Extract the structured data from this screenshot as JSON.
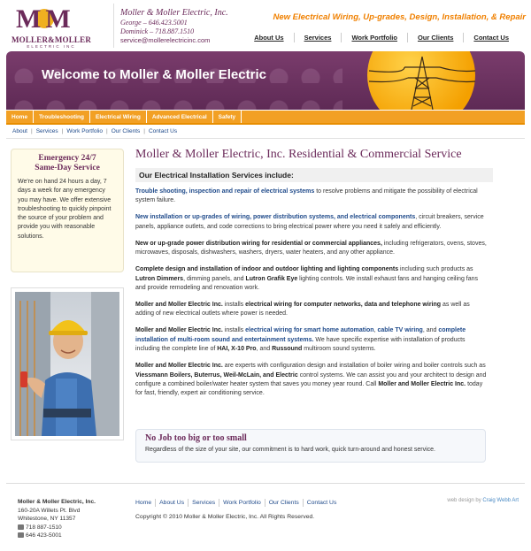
{
  "header": {
    "logo_mark_left": "M",
    "logo_mark_amp": "&",
    "logo_mark_right": "M",
    "logo_name": "MOLLER&MOLLER",
    "logo_sub": "ELECTRIC INC",
    "company": "Moller & Moller Electric, Inc.",
    "george": "George – 646.423.5001",
    "dominick": "Dominick – 718.887.1510",
    "email": "service@mollerelectricinc.com",
    "tagline": "New Electrical Wiring, Up-grades, Design, Installation, & Repair",
    "nav": [
      "About Us",
      "Services",
      "Work Portfolio",
      "Our Clients",
      "Contact Us"
    ]
  },
  "banner": {
    "title": "Welcome to Moller & Moller Electric"
  },
  "orange_nav": [
    "Home",
    "Troubleshooting",
    "Electrical Wiring",
    "Advanced Electrical",
    "Safety"
  ],
  "sub_nav": [
    "About",
    "Services",
    "Work Portfolio",
    "Our Clients",
    "Contact Us"
  ],
  "emergency": {
    "title_line1": "Emergency 24/7",
    "title_line2": "Same-Day Service",
    "body": "We're on hand 24 hours a day, 7 days a week for any emergency you may have. We offer extensive troubleshooting to quickly pinpoint the source of your problem and provide you with reasonable solutions."
  },
  "main": {
    "title": "Moller & Moller Electric, Inc. Residential & Commercial Service",
    "section_heading": "Our Electrical Installation Services include:",
    "p1_blue": "Trouble shooting, inspection and repair of electrical systems",
    "p1_rest": " to resolve problems and mitigate the possibility of electrical system failure.",
    "p2_blue": "New installation or up-grades of wiring, power distribution systems, and electrical components",
    "p2_rest": ", circuit breakers, service panels, appliance outlets, and code corrections to bring electrical power where you need it safely and efficiently.",
    "p3_bold": "New or up-grade power distribution wiring for residential or commercial appliances,",
    "p3_rest": " including refrigerators, ovens, stoves, microwaves, disposals, dishwashers, washers, dryers, water heaters, and any other appliance.",
    "p4_bold": "Complete design and installation of indoor and outdoor lighting and lighting components",
    "p4_rest_a": " including such products as ",
    "p4_b2": "Lutron Dimmers",
    "p4_rest_b": ", dimming panels, and ",
    "p4_b3": "Lutron Grafik Eye",
    "p4_rest_c": " lighting controls. We install exhaust fans and hanging ceiling fans and provide remodeling and renovation work.",
    "p5_bold": "Moller and Moller Electric Inc.",
    "p5_rest_a": " installs ",
    "p5_b2": "electrical wiring for computer networks, data and telephone wiring",
    "p5_rest_b": " as well as adding of new electrical outlets where power is needed.",
    "p6_bold": "Moller and Moller Electric Inc.",
    "p6_rest_a": " installs ",
    "p6_blue1": "electrical wiring for smart home automation",
    "p6_sep": ", ",
    "p6_blue2": "cable TV wiring",
    "p6_rest_b": ", and ",
    "p6_blue3": "complete installation of multi-room sound and entertainment systems.",
    "p6_rest_c": " We have specific expertise with installation of products including the complete line of ",
    "p6_b4": "HAI, X-10 Pro",
    "p6_rest_d": ", and ",
    "p6_b5": "Russound",
    "p6_rest_e": " multiroom sound systems.",
    "p7_bold": "Moller and Moller Electric Inc.",
    "p7_rest_a": " are experts with configuration design and installation of boiler wiring and boiler controls such as ",
    "p7_b2": "Viessmann Boilers, Buterrus, Weil-McLain, and Electric",
    "p7_rest_b": " control systems. We can assist you and your architect to design and configure a combined boiler/water heater system that saves you money year round. Call ",
    "p7_b3": "Moller and Moller Electric Inc.",
    "p7_rest_c": " today for fast, friendly, expert air conditioning service."
  },
  "nojob": {
    "title": "No Job too big or too small",
    "text": "Regardless of the size of your site, our commitment is to hard work, quick turn-around and honest service."
  },
  "footer": {
    "name": "Moller & Moller Electric, Inc.",
    "address1": "160-20A Willets Pt. Blvd",
    "address2": "Whitestone, NY 11357",
    "phone1": "718 887-1510",
    "phone2": "646 423-5001",
    "nav": [
      "Home",
      "About Us",
      "Services",
      "Work Portfolio",
      "Our Clients",
      "Contact Us"
    ],
    "copyright": "Copyright © 2010 Moller & Moller Electric, Inc.  All Rights Reserved.",
    "webdesign_prefix": "web design by ",
    "webdesign_link": "Craig Webb Art"
  },
  "colors": {
    "brand_purple": "#6b2a5a",
    "accent_orange": "#f08000",
    "link_blue": "#1f4a8a",
    "nav_orange": "#f2a024"
  }
}
